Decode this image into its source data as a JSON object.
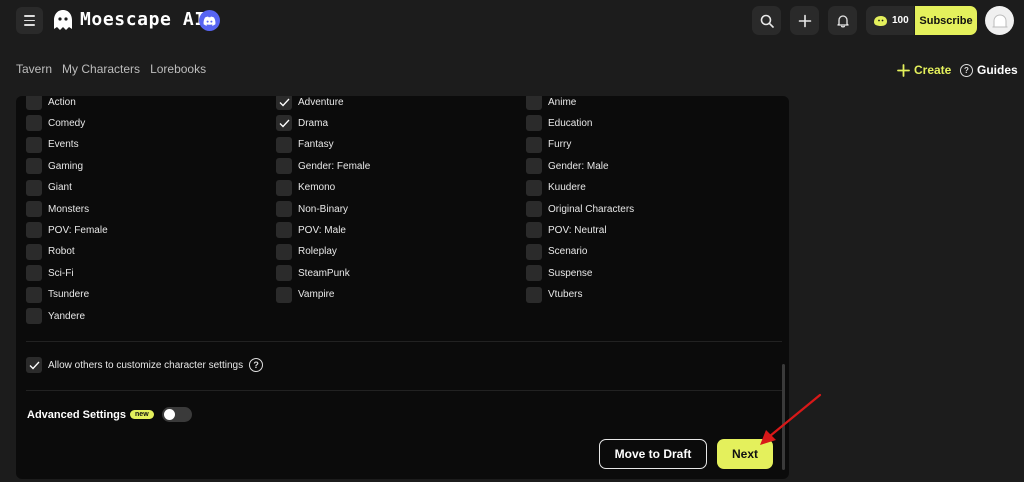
{
  "header": {
    "brand": "Moescape AI",
    "credits": "100",
    "subscribe_label": "Subscribe"
  },
  "nav": {
    "links": [
      "Tavern",
      "My Characters",
      "Lorebooks"
    ],
    "create_label": "Create",
    "guides_label": "Guides"
  },
  "tags": {
    "col1": [
      {
        "label": "Action",
        "checked": false
      },
      {
        "label": "Comedy",
        "checked": false
      },
      {
        "label": "Events",
        "checked": false
      },
      {
        "label": "Gaming",
        "checked": false
      },
      {
        "label": "Giant",
        "checked": false
      },
      {
        "label": "Monsters",
        "checked": false
      },
      {
        "label": "POV: Female",
        "checked": false
      },
      {
        "label": "Robot",
        "checked": false
      },
      {
        "label": "Sci-Fi",
        "checked": false
      },
      {
        "label": "Tsundere",
        "checked": false
      },
      {
        "label": "Yandere",
        "checked": false
      }
    ],
    "col2": [
      {
        "label": "Adventure",
        "checked": true
      },
      {
        "label": "Drama",
        "checked": true
      },
      {
        "label": "Fantasy",
        "checked": false
      },
      {
        "label": "Gender: Female",
        "checked": false
      },
      {
        "label": "Kemono",
        "checked": false
      },
      {
        "label": "Non-Binary",
        "checked": false
      },
      {
        "label": "POV: Male",
        "checked": false
      },
      {
        "label": "Roleplay",
        "checked": false
      },
      {
        "label": "SteamPunk",
        "checked": false
      },
      {
        "label": "Vampire",
        "checked": false
      }
    ],
    "col3": [
      {
        "label": "Anime",
        "checked": false
      },
      {
        "label": "Education",
        "checked": false
      },
      {
        "label": "Furry",
        "checked": false
      },
      {
        "label": "Gender: Male",
        "checked": false
      },
      {
        "label": "Kuudere",
        "checked": false
      },
      {
        "label": "Original Characters",
        "checked": false
      },
      {
        "label": "POV: Neutral",
        "checked": false
      },
      {
        "label": "Scenario",
        "checked": false
      },
      {
        "label": "Suspense",
        "checked": false
      },
      {
        "label": "Vtubers",
        "checked": false
      }
    ]
  },
  "settings": {
    "allow_customize_label": "Allow others to customize character settings",
    "allow_customize_checked": true,
    "help_glyph": "?",
    "advanced_label": "Advanced Settings",
    "new_badge": "new",
    "advanced_enabled": false
  },
  "actions": {
    "draft_label": "Move to Draft",
    "next_label": "Next"
  },
  "colors": {
    "accent": "#e4f05c",
    "annotation_arrow": "#d81818"
  },
  "icons": {
    "menu": "hamburger-icon",
    "logo": "ghost-logo-icon",
    "discord": "discord-icon",
    "search": "search-icon",
    "add": "plus-icon",
    "notifications": "bell-icon",
    "credits": "coin-blob-icon",
    "avatar": "avatar-icon",
    "guides": "help-circle-icon"
  }
}
